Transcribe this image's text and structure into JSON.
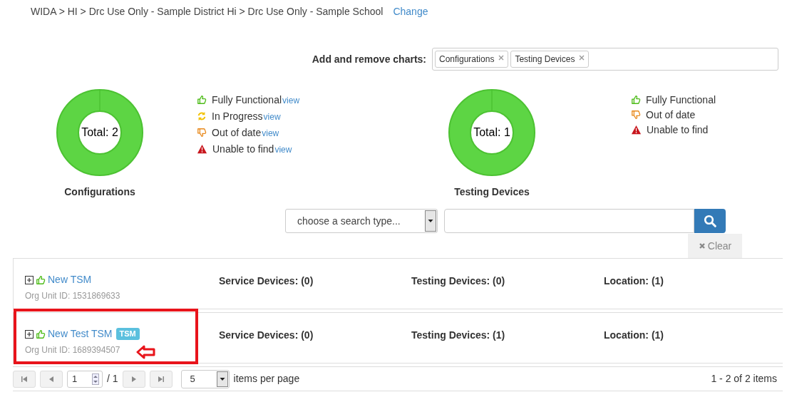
{
  "breadcrumb": {
    "path": "WIDA > HI > Drc Use Only - Sample District Hi > Drc Use Only - Sample School",
    "change_link": "Change"
  },
  "chart_picker": {
    "label": "Add and remove charts:",
    "tags": [
      "Configurations",
      "Testing Devices"
    ]
  },
  "charts": [
    {
      "title": "Configurations",
      "total": "Total: 2",
      "legend": [
        {
          "kind": "functional",
          "label": "Fully Functional",
          "link": "view"
        },
        {
          "kind": "progress",
          "label": "In Progress",
          "link": "view"
        },
        {
          "kind": "outdated",
          "label": "Out of date",
          "link": "view"
        },
        {
          "kind": "missing",
          "label": "Unable to find",
          "link": "view"
        }
      ]
    },
    {
      "title": "Testing Devices",
      "total": "Total: 1",
      "legend": [
        {
          "kind": "functional",
          "label": "Fully Functional"
        },
        {
          "kind": "outdated",
          "label": "Out of date"
        },
        {
          "kind": "missing",
          "label": "Unable to find"
        }
      ]
    }
  ],
  "search": {
    "type_placeholder": "choose a search type...",
    "clear": "Clear"
  },
  "rows": [
    {
      "name": "New TSM",
      "org_id": "Org Unit ID: 1531869633",
      "service": "Service Devices: (0)",
      "testing": "Testing Devices: (0)",
      "location": "Location: (1)",
      "annotated": false
    },
    {
      "name": "New Test TSM",
      "badge": "TSM",
      "org_id": "Org Unit ID: 1689394507",
      "service": "Service Devices: (0)",
      "testing": "Testing Devices: (1)",
      "location": "Location: (1)",
      "annotated": true
    }
  ],
  "pager": {
    "page": "1",
    "of": "/ 1",
    "page_size": "5",
    "per_page_label": "items per page",
    "summary": "1 - 2 of 2 items"
  }
}
